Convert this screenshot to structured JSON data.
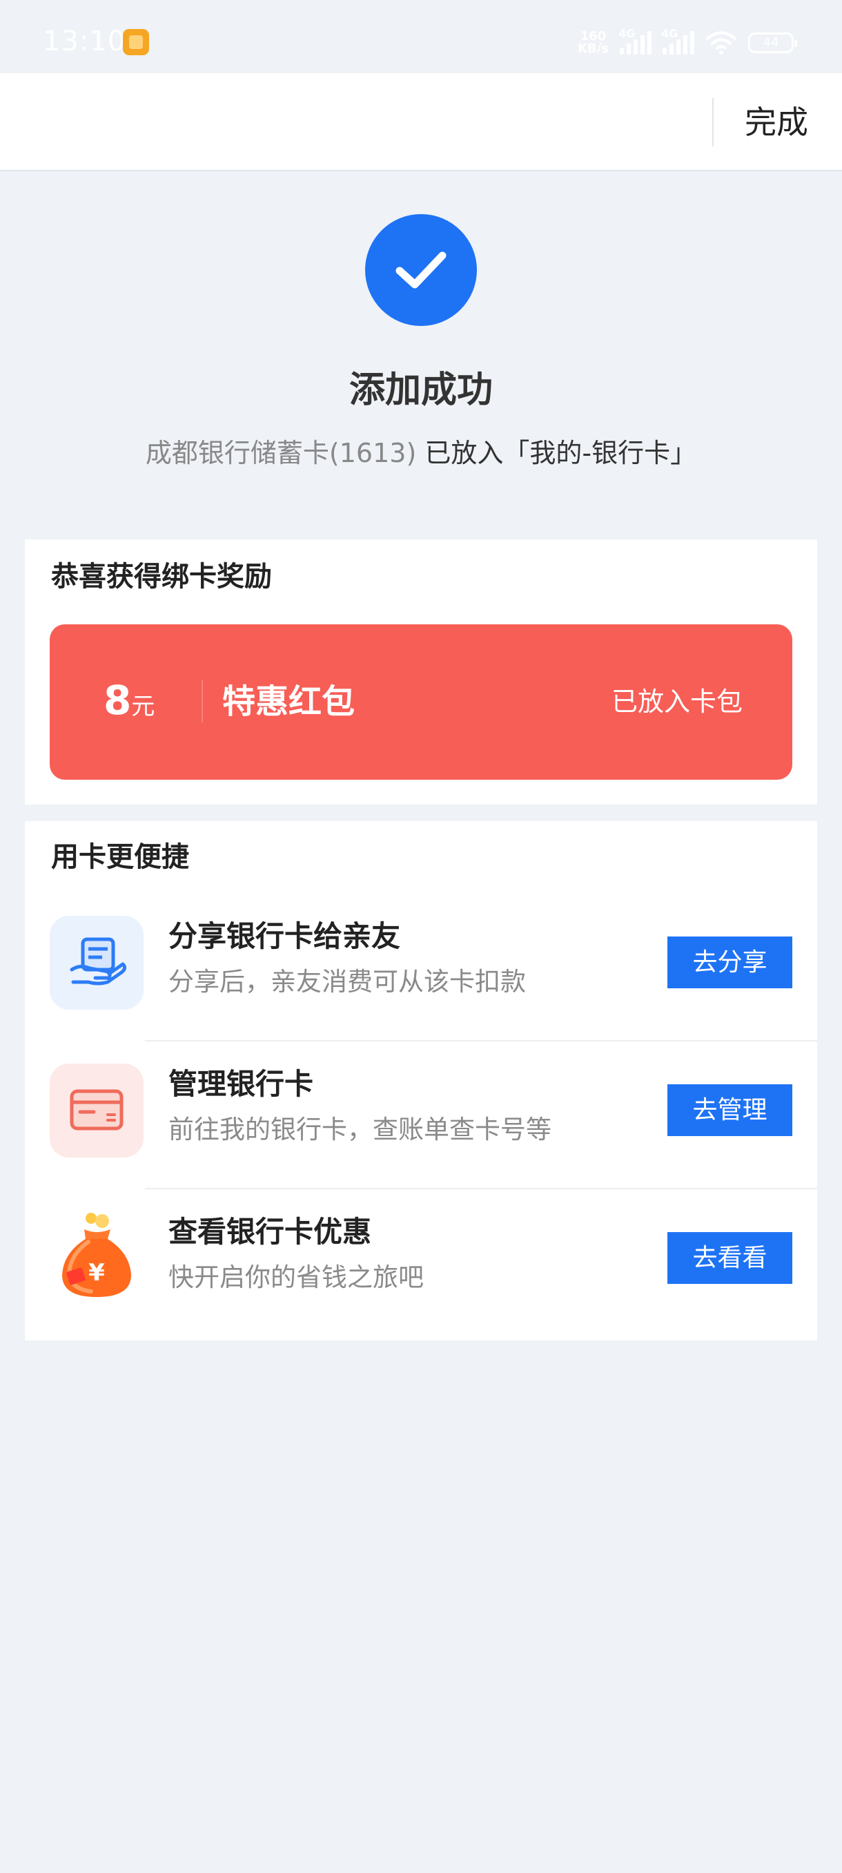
{
  "status_bar": {
    "time": "13:10",
    "net_speed_value": "160",
    "net_speed_unit": "KB/s",
    "signal1_tag": "4G",
    "signal2_tag": "4G",
    "battery": "44"
  },
  "nav": {
    "done_label": "完成"
  },
  "success": {
    "title": "添加成功",
    "card_name": "成都银行储蓄卡(1613)",
    "placed_text": " 已放入「我的-银行卡」",
    "accent_color": "#1e73f5"
  },
  "reward": {
    "section_title": "恭喜获得绑卡奖励",
    "amount": "8",
    "unit": "元",
    "name": "特惠红包",
    "status": "已放入卡包",
    "coupon_color": "#f75e56"
  },
  "convenience": {
    "section_title": "用卡更便捷",
    "items": [
      {
        "icon": "share-card-icon",
        "title": "分享银行卡给亲友",
        "desc": "分享后，亲友消费可从该卡扣款",
        "button": "去分享"
      },
      {
        "icon": "manage-card-icon",
        "title": "管理银行卡",
        "desc": "前往我的银行卡，查账单查卡号等",
        "button": "去管理"
      },
      {
        "icon": "money-bag-icon",
        "title": "查看银行卡优惠",
        "desc": "快开启你的省钱之旅吧",
        "button": "去看看"
      }
    ]
  }
}
